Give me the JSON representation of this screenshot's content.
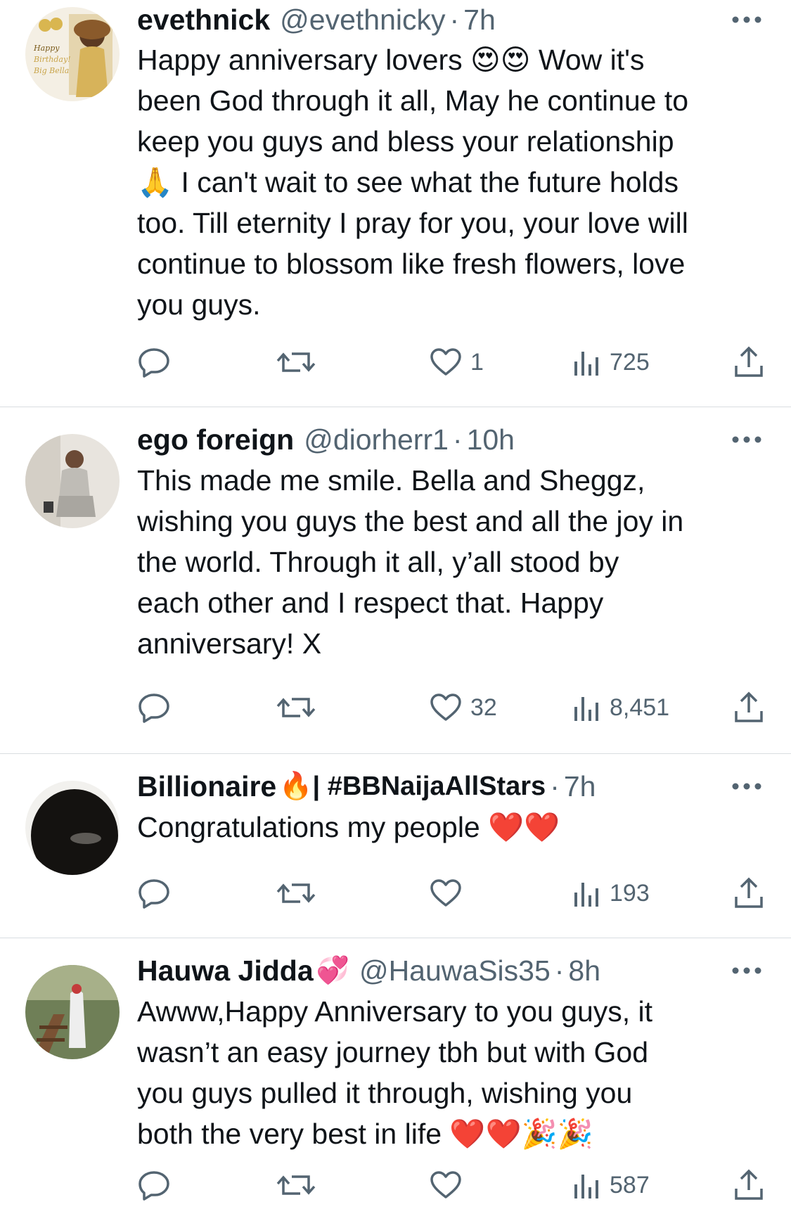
{
  "tweets": [
    {
      "name": "evethnick",
      "name_badge": "",
      "handle": "@evethnicky",
      "time": "7h",
      "text": "Happy anniversary lovers 😍😍 Wow it's\nbeen God through it all, May he continue to\nkeep you guys and bless your relationship\n🙏 I can't wait to see what the future holds\ntoo. Till eternity I pray for you, your love will\ncontinue to blossom like fresh flowers, love\nyou guys.",
      "likes": "1",
      "views": "725",
      "avatar_text": "Happy Birthday! Big Bella"
    },
    {
      "name": "ego foreign",
      "name_badge": "",
      "handle": "@diorherr1",
      "time": "10h",
      "text": "This made me smile. Bella and Sheggz,\nwishing you guys the best and all the joy in\nthe world. Through it all, y’all stood by\neach other and I respect that. Happy\nanniversary! X",
      "likes": "32",
      "views": "8,451"
    },
    {
      "name": "Billionaire",
      "name_badge": "🔥| #BBNaijaAllStars",
      "handle": "",
      "time": "7h",
      "text": "Congratulations my people ❤️❤️",
      "likes": "",
      "views": "193"
    },
    {
      "name": "Hauwa Jidda",
      "name_badge": "💞",
      "handle": "@HauwaSis35",
      "time": "8h",
      "text": "Awww,Happy Anniversary to you guys, it\nwasn’t an easy journey tbh but with God\nyou guys pulled it through, wishing you\nboth the very best in life ❤️❤️🎉🎉",
      "likes": "",
      "views": "587"
    }
  ],
  "separator": "·",
  "colors": {
    "text": "#0f1419",
    "secondary": "#536471",
    "divider": "#d9dde1"
  },
  "icons": [
    "reply-icon",
    "retweet-icon",
    "like-icon",
    "views-icon",
    "share-icon",
    "more-icon"
  ]
}
